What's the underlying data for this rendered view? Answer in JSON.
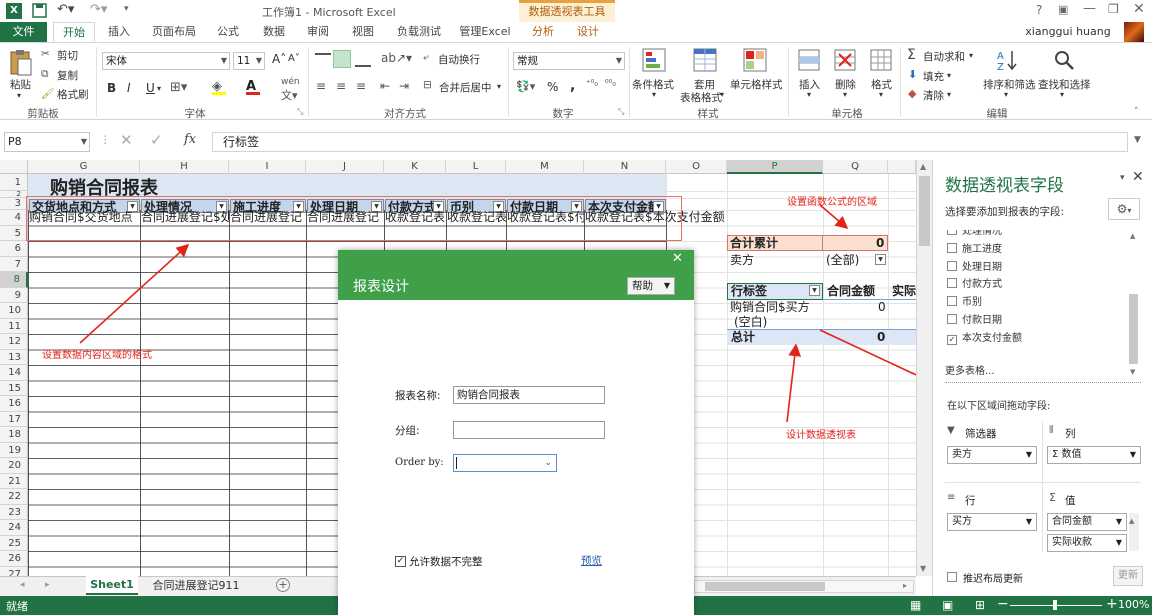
{
  "titlebar": {
    "title": "工作簿1 - Microsoft Excel",
    "context_tab": "数据透视表工具",
    "help": "?"
  },
  "tabs": {
    "file": "文件",
    "home": "开始",
    "insert": "插入",
    "layout": "页面布局",
    "formulas": "公式",
    "data": "数据",
    "review": "审阅",
    "view": "视图",
    "loadtest": "负载测试",
    "manageexcel": "管理Excel",
    "analyze": "分析",
    "design": "设计",
    "user": "xianggui huang"
  },
  "ribbon": {
    "paste": "粘贴",
    "cut": "剪切",
    "copy": "复制",
    "format_painter": "格式刷",
    "clipboard": "剪贴板",
    "font_name": "宋体",
    "font_size": "11",
    "bold": "B",
    "italic": "I",
    "underline": "U",
    "font_group": "字体",
    "font_color_letter": "A",
    "wen": "wén",
    "wrap": "自动换行",
    "merge": "合并后居中",
    "align_group": "对齐方式",
    "numfmt": "常规",
    "percent": "%",
    "comma": ",",
    "number_group": "数字",
    "cond_fmt": "条件格式",
    "table_fmt": "套用",
    "table_fmt2": "表格格式",
    "cell_style": "单元格样式",
    "styles_group": "样式",
    "insert": "插入",
    "delete": "删除",
    "format": "格式",
    "cells_group": "单元格",
    "autosum": "自动求和",
    "fill": "填充",
    "clear": "清除",
    "sort_filter": "排序和筛选",
    "find_select": "查找和选择",
    "edit_group": "编辑"
  },
  "formula_bar": {
    "name_box": "P8",
    "fx": "fx",
    "content": "行标签"
  },
  "columns": [
    "G",
    "H",
    "I",
    "J",
    "K",
    "L",
    "M",
    "N",
    "O",
    "P",
    "Q"
  ],
  "rows": [
    "1",
    "2",
    "3",
    "4",
    "5",
    "6",
    "7",
    "8",
    "9",
    "10",
    "11",
    "12",
    "13",
    "14",
    "15",
    "16",
    "17",
    "18",
    "19",
    "20",
    "21",
    "22",
    "23",
    "24",
    "25",
    "26",
    "27"
  ],
  "sheet": {
    "title": "购销合同报表",
    "headers": [
      "交货地点和方式",
      "处理情况",
      "施工进度",
      "处理日期",
      "付款方式",
      "币别",
      "付款日期",
      "本次支付金额"
    ],
    "row4": [
      "购销合同$交货地点",
      "合同进展登记$处",
      "合同进展登记",
      "合同进展登记",
      "收款登记表",
      "收款登记表",
      "收款登记表$付",
      "收款登记表$本次支付金额"
    ]
  },
  "pivot": {
    "sum_label": "合计累计",
    "sum_value": "0",
    "filter_label": "卖方",
    "filter_value": "(全部)",
    "row_label": "行标签",
    "col_amount": "合同金额",
    "col_actual": "实际",
    "item1": "购销合同$买方",
    "item2": "(空白)",
    "item_value": "0",
    "total_label": "总计",
    "total_value": "0"
  },
  "notes": {
    "formula_area": "设置函数公式的区域",
    "content_format": "设置数据内容区域的格式",
    "design_pivot": "设计数据透视表"
  },
  "sheet_tabs": [
    "Sheet1",
    "合同进展登记911"
  ],
  "status": {
    "ready": "就绪",
    "zoom": "100%"
  },
  "pane": {
    "title": "数据透视表字段",
    "subtitle": "选择要添加到报表的字段:",
    "fields": [
      {
        "label": "处理情况",
        "checked": false
      },
      {
        "label": "施工进度",
        "checked": false
      },
      {
        "label": "处理日期",
        "checked": false
      },
      {
        "label": "付款方式",
        "checked": false
      },
      {
        "label": "币别",
        "checked": false
      },
      {
        "label": "付款日期",
        "checked": false
      },
      {
        "label": "本次支付金额",
        "checked": true
      }
    ],
    "more_tables": "更多表格...",
    "drag_hint": "在以下区域间拖动字段:",
    "filters_label": "筛选器",
    "columns_label": "列",
    "rows_label": "行",
    "values_label": "值",
    "filter_item": "卖方",
    "column_item": "Σ 数值",
    "row_item": "买方",
    "value_item1": "合同金额",
    "value_item2": "实际收款",
    "defer": "推迟布局更新",
    "update": "更新"
  },
  "dialog": {
    "title": "报表设计",
    "help_button": "帮助",
    "name_label": "报表名称:",
    "name_value": "购销合同报表",
    "group_label": "分组:",
    "group_value": "",
    "order_label": "Order by:",
    "order_value": "",
    "allow_incomplete": "允许数据不完整",
    "preview": "预览"
  },
  "colors": {
    "excel_green": "#217346",
    "dialog_green": "#3fa049",
    "note_red": "#e2231a",
    "header_blue": "#c5d5ec",
    "sum_peach": "#fbe0d0"
  }
}
